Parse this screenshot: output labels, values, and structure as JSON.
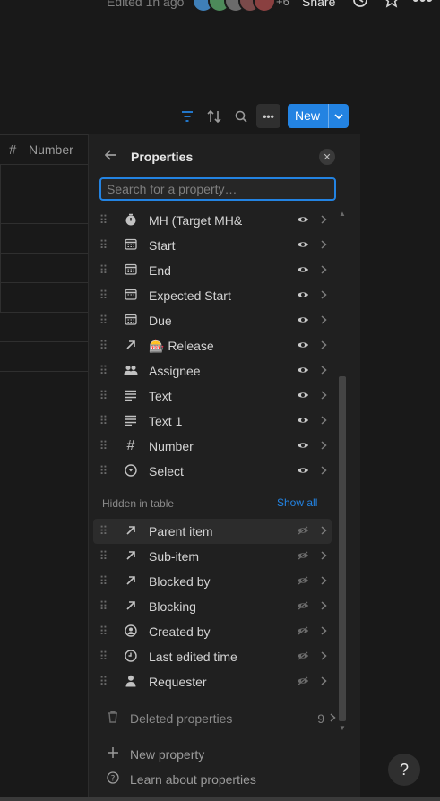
{
  "topbar": {
    "edited": "Edited 1h ago",
    "extra_count": "+6",
    "share": "Share",
    "icons": [
      "history-icon",
      "star-icon",
      "more-icon"
    ]
  },
  "toolbar": {
    "icons": [
      "filter-icon",
      "sort-icon",
      "search-icon",
      "more-icon"
    ],
    "new_label": "New"
  },
  "table": {
    "column": "Number"
  },
  "panel": {
    "title": "Properties",
    "search_placeholder": "Search for a property…",
    "visible": [
      {
        "label": "MH (Target MH&",
        "icon": "formula-icon"
      },
      {
        "label": "Start",
        "icon": "calendar-icon"
      },
      {
        "label": "End",
        "icon": "calendar-icon"
      },
      {
        "label": "Expected Start",
        "icon": "calendar-icon"
      },
      {
        "label": "Due",
        "icon": "calendar-icon"
      },
      {
        "label": "🎰 Release",
        "icon": "relation-icon"
      },
      {
        "label": "Assignee",
        "icon": "people-icon"
      },
      {
        "label": "Text",
        "icon": "text-icon"
      },
      {
        "label": "Text 1",
        "icon": "text-icon"
      },
      {
        "label": "Number",
        "icon": "number-icon"
      },
      {
        "label": "Select",
        "icon": "select-icon"
      }
    ],
    "hidden_label": "Hidden in table",
    "show_all": "Show all",
    "hidden": [
      {
        "label": "Parent item",
        "icon": "relation-icon"
      },
      {
        "label": "Sub-item",
        "icon": "relation-icon"
      },
      {
        "label": "Blocked by",
        "icon": "relation-icon"
      },
      {
        "label": "Blocking",
        "icon": "relation-icon"
      },
      {
        "label": "Created by",
        "icon": "person-circle-icon"
      },
      {
        "label": "Last edited time",
        "icon": "clock-icon"
      },
      {
        "label": "Requester",
        "icon": "person-icon"
      }
    ],
    "deleted_label": "Deleted properties",
    "deleted_count": "9",
    "new_property": "New property",
    "learn": "Learn about properties"
  },
  "help": "?"
}
